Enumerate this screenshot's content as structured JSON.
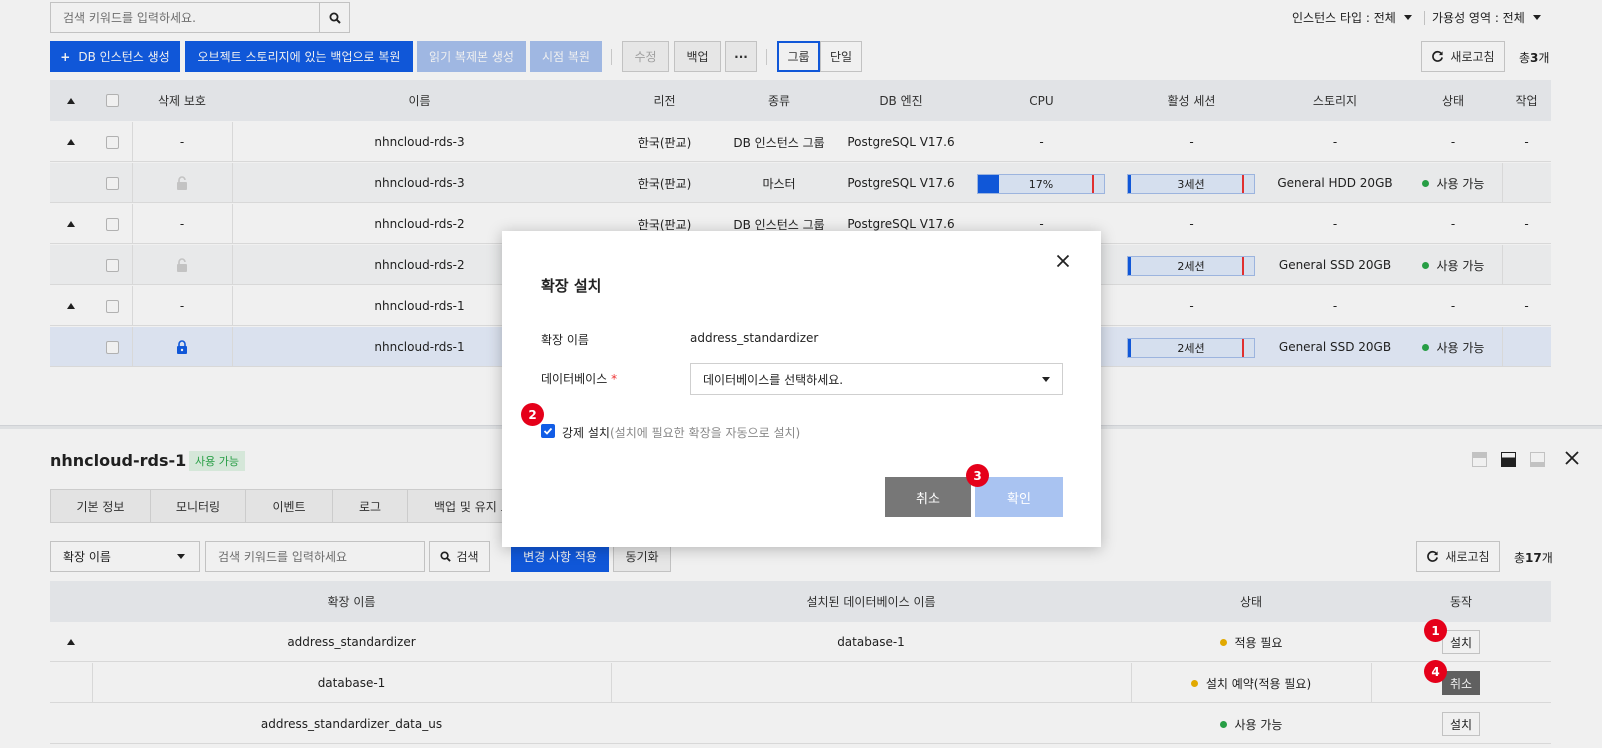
{
  "toolbar": {
    "search_placeholder": "검색 키워드를 입력하세요.",
    "instance_type_label": "인스턴스 타입 : 전체",
    "availability_zone_label": "가용성 영역 : 전체",
    "create_btn": "DB 인스턴스 생성",
    "restore_btn": "오브젝트 스토리지에 있는 백업으로 복원",
    "read_replica_btn": "읽기 복제본 생성",
    "point_restore_btn": "시점 복원",
    "edit_btn": "수정",
    "backup_btn": "백업",
    "more_btn": "···",
    "group_btn": "그룹",
    "single_btn": "단일",
    "refresh_btn": "새로고침",
    "total_prefix": "총",
    "total_count": "3",
    "total_suffix": "개"
  },
  "instances": {
    "headers": [
      "삭제 보호",
      "이름",
      "리전",
      "종류",
      "DB 엔진",
      "CPU",
      "활성 세션",
      "스토리지",
      "상태",
      "작업"
    ],
    "rows": [
      {
        "protect": "-",
        "name": "nhncloud-rds-3",
        "region": "한국(판교)",
        "kind": "DB 인스턴스 그룹",
        "engine": "PostgreSQL V17.6",
        "cpu": "-",
        "session": "-",
        "storage": "-",
        "status": "-",
        "action": "-"
      },
      {
        "name": "nhncloud-rds-3",
        "region": "한국(판교)",
        "kind": "마스터",
        "engine": "PostgreSQL V17.6",
        "cpu": "17%",
        "cpu_pct": 17,
        "session": "3세션",
        "session_pct": 2,
        "storage": "General HDD 20GB",
        "status": "사용 가능"
      },
      {
        "protect": "-",
        "name": "nhncloud-rds-2",
        "region": "한국(판교)",
        "kind": "DB 인스턴스 그룹",
        "engine": "PostgreSQL V17.6",
        "cpu": "-",
        "session": "-",
        "storage": "-",
        "status": "-",
        "action": "-"
      },
      {
        "name": "nhncloud-rds-2",
        "session": "2세션",
        "storage": "General SSD 20GB",
        "status": "사용 가능"
      },
      {
        "protect": "-",
        "name": "nhncloud-rds-1",
        "session": "-",
        "storage": "-",
        "status": "-",
        "action": "-"
      },
      {
        "name": "nhncloud-rds-1",
        "session": "2세션",
        "storage": "General SSD 20GB",
        "status": "사용 가능"
      }
    ]
  },
  "detail": {
    "title": "nhncloud-rds-1",
    "status_badge": "사용 가능",
    "tabs": [
      "기본 정보",
      "모니터링",
      "이벤트",
      "로그",
      "백업 및 유지 보수"
    ],
    "filter_select": "확장 이름",
    "search_placeholder": "검색 키워드를 입력하세요",
    "search_btn": "검색",
    "apply_btn": "변경 사항 적용",
    "sync_btn": "동기화",
    "refresh_btn": "새로고침",
    "total_prefix": "총",
    "total_count": "17",
    "total_suffix": "개",
    "headers": [
      "확장 이름",
      "설치된 데이터베이스 이름",
      "상태",
      "동작"
    ],
    "rows": [
      {
        "name": "address_standardizer",
        "db": "database-1",
        "status": "적용 필요",
        "action": "설치"
      },
      {
        "name": "database-1",
        "db": "",
        "status": "설치 예약(적용 필요)",
        "action": "취소"
      },
      {
        "name": "address_standardizer_data_us",
        "db": "",
        "status": "사용 가능",
        "action": "설치"
      }
    ]
  },
  "modal": {
    "title": "확장 설치",
    "ext_name_label": "확장 이름",
    "ext_name_value": "address_standardizer",
    "db_label": "데이터베이스",
    "required_mark": "*",
    "db_placeholder": "데이터베이스를 선택하세요.",
    "force_label": "강제 설치",
    "force_hint": "(설치에 필요한 확장을 자동으로 설치)",
    "cancel_btn": "취소",
    "confirm_btn": "확인"
  },
  "annotations": [
    "1",
    "2",
    "3",
    "4"
  ],
  "colors": {
    "primary": "#125de6",
    "green": "#2aa84a",
    "yellow": "#f0b400",
    "red_badge": "#e5001a"
  }
}
